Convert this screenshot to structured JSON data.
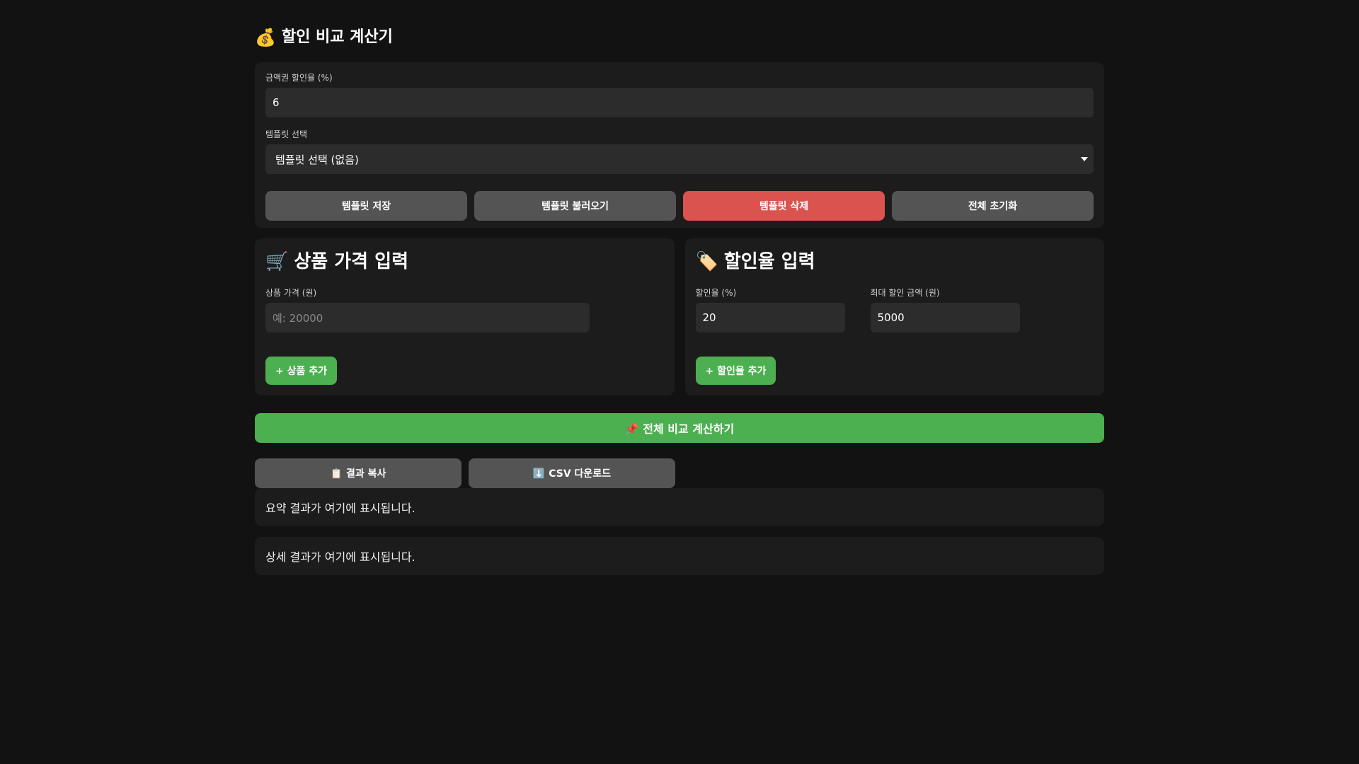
{
  "header": {
    "icon": "money-bag-icon",
    "icon_glyph": "💰",
    "title": "할인 비교 계산기"
  },
  "settings": {
    "voucher_label": "금액권 할인율 (%)",
    "voucher_value": "6",
    "template_label": "템플릿 선택",
    "template_selected": "템플릿 선택 (없음)",
    "buttons": {
      "save": "템플릿 저장",
      "load": "템플릿 불러오기",
      "delete": "템플릿 삭제",
      "reset": "전체 초기화"
    }
  },
  "product_panel": {
    "icon": "cart-icon",
    "icon_glyph": "🛒",
    "title": "상품 가격 입력",
    "price_label": "상품 가격 (원)",
    "price_placeholder": "예: 20000",
    "add_label": "+ 상품 추가"
  },
  "discount_panel": {
    "icon": "tag-icon",
    "icon_glyph": "🏷️",
    "title": "할인율 입력",
    "rate_label": "할인율 (%)",
    "rate_value": "20",
    "max_label": "최대 할인 금액 (원)",
    "max_value": "5000",
    "add_label": "+ 할인율 추가"
  },
  "calculate_label": "📌 전체 비교 계산하기",
  "actions": {
    "copy_label": "📋 결과 복사",
    "csv_label": "⬇️ CSV 다운로드"
  },
  "results": {
    "summary": "요약 결과가 여기에 표시됩니다.",
    "detail": "상세 결과가 여기에 표시됩니다."
  },
  "colors": {
    "background": "#121212",
    "card": "#1c1c1c",
    "input": "#2c2c2c",
    "gray_button": "#545454",
    "danger": "#d9534f",
    "accent": "#4caf50"
  }
}
